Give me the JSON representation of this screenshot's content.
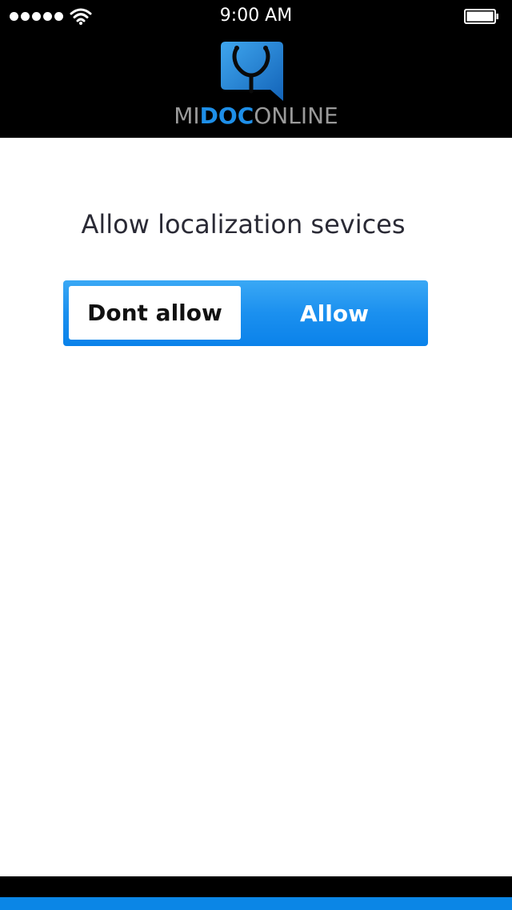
{
  "status_bar": {
    "time": "9:00 AM",
    "signal_icon": "signal-dots-icon",
    "wifi_icon": "wifi-icon",
    "battery_icon": "battery-icon"
  },
  "header": {
    "logo_icon": "stethoscope-chat-icon",
    "logo_mi": "MI",
    "logo_doc": "DOC",
    "logo_online": "ONLINE"
  },
  "main": {
    "prompt": "Allow localization sevices",
    "dont_allow_label": "Dont allow",
    "allow_label": "Allow"
  },
  "colors": {
    "accent": "#1b90ef",
    "header_bg": "#000000",
    "logo_doc": "#1e8fe8",
    "logo_gray": "#9a9a9a",
    "footer_blue": "#0b86e6"
  }
}
